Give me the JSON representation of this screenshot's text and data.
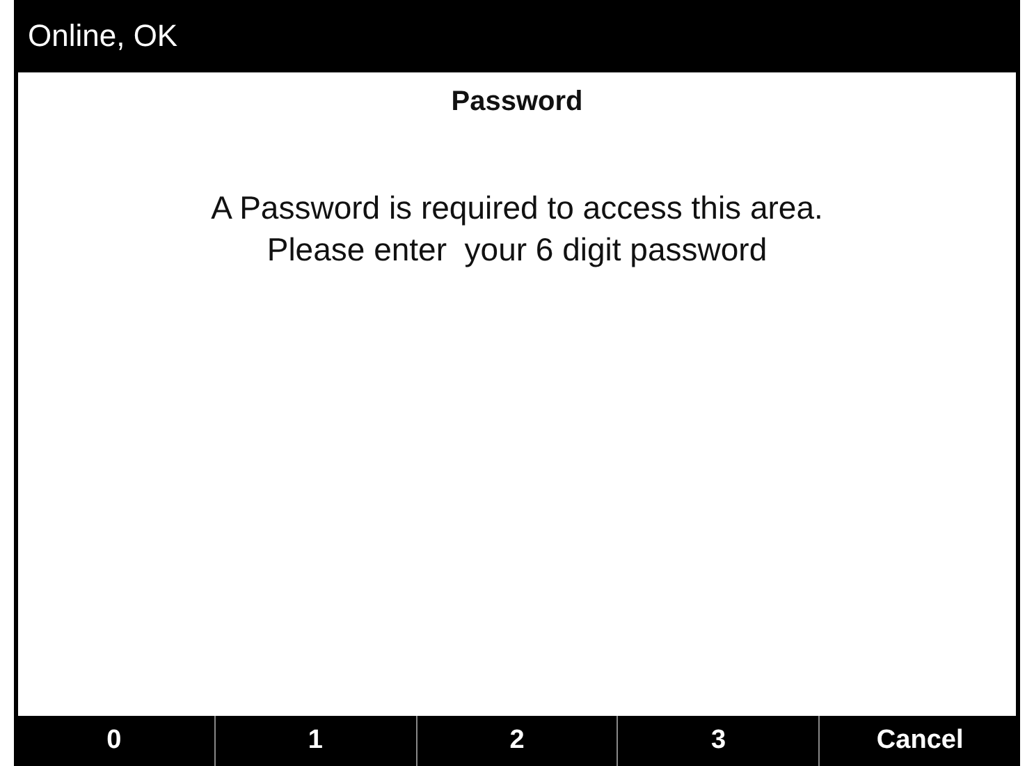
{
  "status_bar": {
    "text": "Online, OK"
  },
  "dialog": {
    "title": "Password",
    "message": "A Password is required to access this area.\nPlease enter  your 6 digit password"
  },
  "softkeys": [
    {
      "label": "0"
    },
    {
      "label": "1"
    },
    {
      "label": "2"
    },
    {
      "label": "3"
    },
    {
      "label": "Cancel"
    }
  ]
}
